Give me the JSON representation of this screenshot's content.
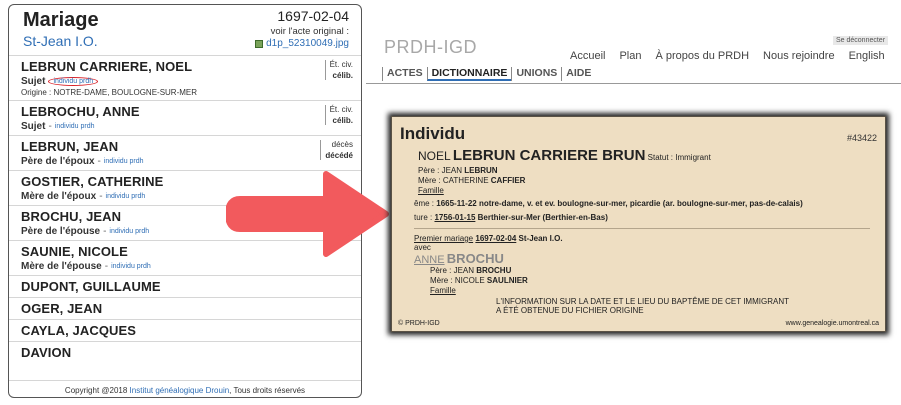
{
  "left_panel": {
    "title": "Mariage",
    "parish": "St-Jean I.O.",
    "date": "1697-02-04",
    "voir_label": "voir l'acte original :",
    "file_name": "d1p_52310049.jpg",
    "entries": [
      {
        "name": "LEBRUN CARRIERE, NOEL",
        "role": "Sujet",
        "link": "individu prdh",
        "origin": "Origine : NOTRE-DAME, BOULOGNE-SUR-MER",
        "status1": "Ét. civ.",
        "status2": "célib."
      },
      {
        "name": "LEBROCHU, ANNE",
        "role": "Sujet",
        "link": "individu prdh",
        "status1": "Ét. civ.",
        "status2": "célib."
      },
      {
        "name": "LEBRUN, JEAN",
        "role": "Père de l'époux",
        "link": "individu prdh",
        "status1": "décès",
        "status2": "décédé"
      },
      {
        "name": "GOSTIER, CATHERINE",
        "role": "Mère de l'époux",
        "link": "individu prdh"
      },
      {
        "name": "BROCHU, JEAN",
        "role": "Père de l'épouse",
        "link": "individu prdh"
      },
      {
        "name": "SAUNIE, NICOLE",
        "role": "Mère de l'épouse",
        "link": "individu prdh"
      },
      {
        "name": "DUPONT, GUILLAUME"
      },
      {
        "name": "OGER, JEAN"
      },
      {
        "name": "CAYLA, JACQUES"
      },
      {
        "name": "DAVION"
      }
    ],
    "footer": {
      "prefix": "Copyright @2018",
      "institute": "Institut généalogique Drouin",
      "suffix": ", Tous droits réservés"
    }
  },
  "right_panel": {
    "brand": "PRDH-IGD",
    "logout": "Se déconnecter",
    "top_nav": [
      "Accueil",
      "Plan",
      "À propos du PRDH",
      "Nous rejoindre",
      "English"
    ],
    "tabs": [
      "ACTES",
      "DICTIONNAIRE",
      "UNIONS",
      "AIDE"
    ],
    "active_tab": "DICTIONNAIRE",
    "card": {
      "title": "Individu",
      "id": "#43422",
      "first_name": "NOEL",
      "last_name": "LEBRUN CARRIERE BRUN",
      "statut": "Statut : Immigrant",
      "pere_label": "Père : JEAN",
      "pere_last": "LEBRUN",
      "mere_label": "Mère : CATHERINE",
      "mere_last": "CAFFIER",
      "famille": "Famille",
      "bapteme_label": "ême :",
      "bapteme_date": "1665-11-22",
      "bapteme_place": "notre-dame, v. et ev. boulogne-sur-mer, picardie (ar. boulogne-sur-mer, pas-de-calais)",
      "sepulture_label": "ture :",
      "sepulture_date": "1756-01-15",
      "sepulture_place": "Berthier-sur-Mer (Berthier-en-Bas)",
      "mariage_label": "Premier mariage",
      "mariage_date": "1697-02-04",
      "mariage_place": "St-Jean I.O.",
      "avec": "avec",
      "spouse_first": "ANNE",
      "spouse_last": "BROCHU",
      "spouse_pere_label": "Père : JEAN",
      "spouse_pere_last": "BROCHU",
      "spouse_mere_label": "Mère : NICOLE",
      "spouse_mere_last": "SAULNIER",
      "spouse_famille": "Famille",
      "note_line1": "L'INFORMATION SUR LA DATE ET LE LIEU DU BAPTÊME DE CET IMMIGRANT",
      "note_line2": "A ÉTÉ OBTENUE DU FICHIER ORIGINE",
      "footer_left": "© PRDH-IGD",
      "footer_right": "www.genealogie.umontreal.ca"
    }
  },
  "colors": {
    "arrow": "#f25a5d",
    "link": "#2f6eb5",
    "highlight_circle": "#d8232a",
    "card_bg": "#eedec2"
  }
}
